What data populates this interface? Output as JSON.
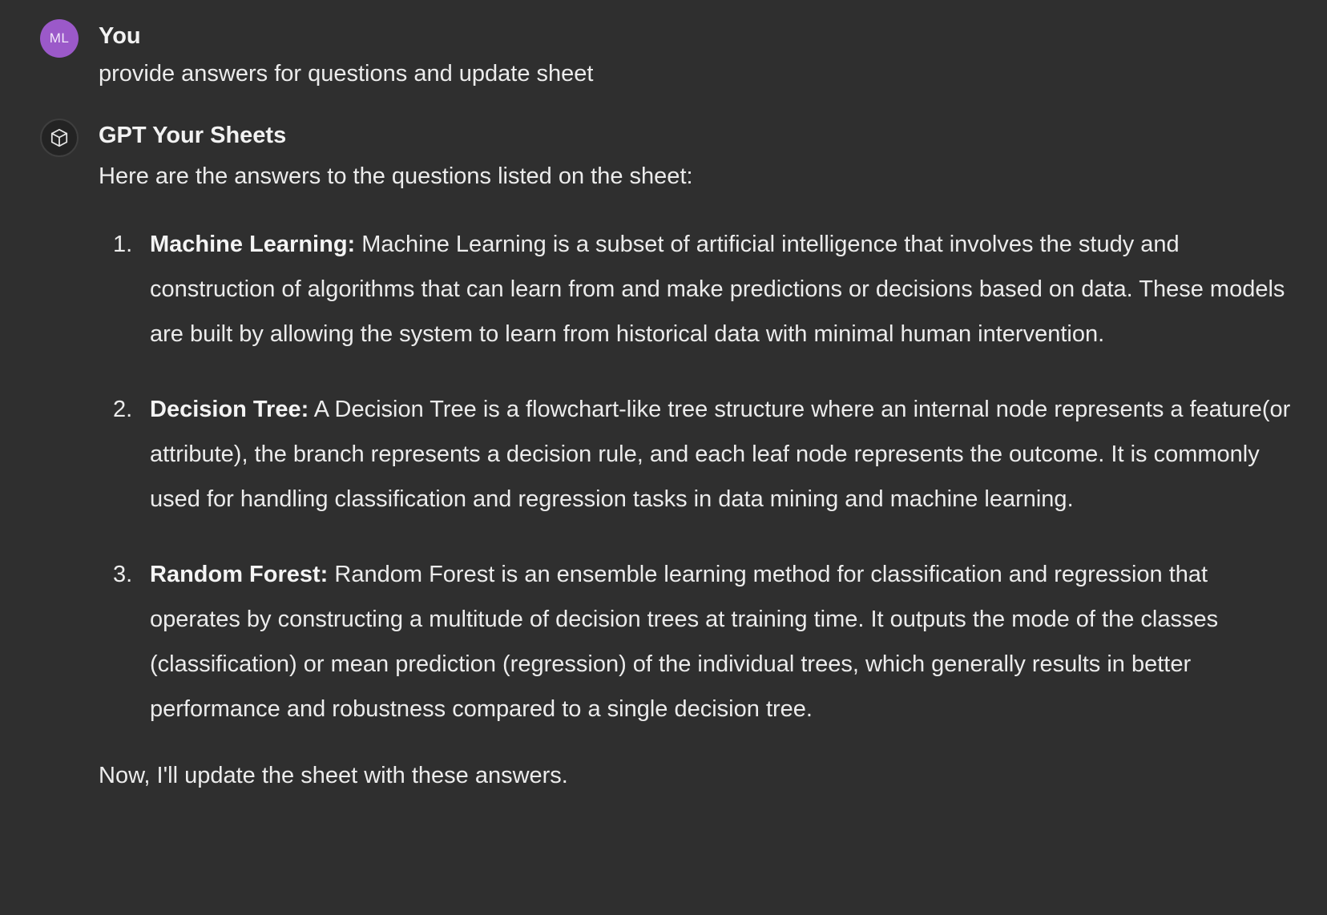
{
  "user_message": {
    "avatar_initials": "ML",
    "author": "You",
    "text": "provide answers for questions and update sheet"
  },
  "assistant_message": {
    "avatar_icon": "cube-icon",
    "author": "GPT Your Sheets",
    "intro": "Here are the answers to the questions listed on the sheet:",
    "answers": [
      {
        "number": "1.",
        "term": "Machine Learning:",
        "text": " Machine Learning is a subset of artificial intelligence that involves the study and construction of algorithms that can learn from and make predictions or decisions based on data. These models are built by allowing the system to learn from historical data with minimal human intervention."
      },
      {
        "number": "2.",
        "term": "Decision Tree:",
        "text": " A Decision Tree is a flowchart-like tree structure where an internal node represents a feature(or attribute), the branch represents a decision rule, and each leaf node represents the outcome. It is commonly used for handling classification and regression tasks in data mining and machine learning."
      },
      {
        "number": "3.",
        "term": "Random Forest:",
        "text": " Random Forest is an ensemble learning method for classification and regression that operates by constructing a multitude of decision trees at training time. It outputs the mode of the classes (classification) or mean prediction (regression) of the individual trees, which generally results in better performance and robustness compared to a single decision tree."
      }
    ],
    "outro": "Now, I'll update the sheet with these answers."
  },
  "colors": {
    "background": "#2f2f2f",
    "text": "#ececec",
    "user_avatar": "#9b59c9"
  }
}
